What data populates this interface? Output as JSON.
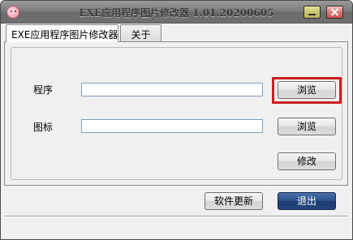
{
  "window": {
    "title": "EXE应用程序图片修改器 1.01.20200605"
  },
  "tabs": [
    {
      "label": "EXE应用程序图片修改器",
      "active": true
    },
    {
      "label": "关于",
      "active": false
    }
  ],
  "form": {
    "program_label": "程序",
    "program_value": "",
    "program_browse": "浏览",
    "icon_label": "图标",
    "icon_value": "",
    "icon_browse": "浏览",
    "modify": "修改"
  },
  "footer": {
    "update_label": "软件更新",
    "exit_label": "退出"
  },
  "colors": {
    "highlight": "#cc1f1f",
    "primary_button": "#2a4f8a"
  },
  "icons": [
    "app-pig-icon",
    "minimize-icon",
    "close-icon"
  ]
}
